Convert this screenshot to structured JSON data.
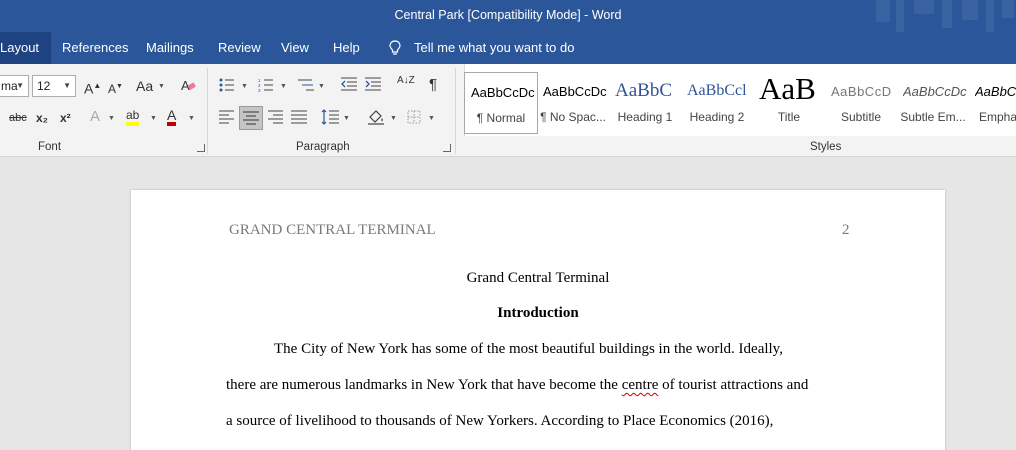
{
  "window": {
    "title": "Central Park [Compatibility Mode]  -  Word"
  },
  "menu": {
    "tabs": [
      "Layout",
      "References",
      "Mailings",
      "Review",
      "View",
      "Help"
    ],
    "tell_me": "Tell me what you want to do"
  },
  "ribbon": {
    "font": {
      "name": "ma",
      "size": "12",
      "group_label": "Font",
      "grow": "A",
      "shrink": "A",
      "case": "Aa",
      "strike": "abc",
      "subscript": "x₂",
      "superscript": "x²",
      "effects": "A",
      "highlight": "ab",
      "font_color": "A"
    },
    "paragraph": {
      "group_label": "Paragraph",
      "sort": "A↓Z",
      "pilcrow": "¶"
    },
    "styles": {
      "group_label": "Styles",
      "items": [
        {
          "preview": "AaBbCcDc",
          "name": "¶ Normal"
        },
        {
          "preview": "AaBbCcDc",
          "name": "¶ No Spac..."
        },
        {
          "preview": "AaBbC",
          "name": "Heading 1"
        },
        {
          "preview": "AaBbCcl",
          "name": "Heading 2"
        },
        {
          "preview": "AaB",
          "name": "Title"
        },
        {
          "preview": "AaBbCcD",
          "name": "Subtitle"
        },
        {
          "preview": "AaBbCcDc",
          "name": "Subtle Em..."
        },
        {
          "preview": "AaBbCc",
          "name": "Empha"
        }
      ]
    }
  },
  "document": {
    "header_left": "GRAND CENTRAL TERMINAL",
    "page_number": "2",
    "title": "Grand Central Terminal",
    "heading": "Introduction",
    "line1": "The City of New York has some of the most beautiful buildings in the world. Ideally,",
    "line2_a": "there are numerous landmarks in New York that have become the ",
    "line2_misspelled": "centre",
    "line2_b": " of tourist attractions and",
    "line3": "a source of livelihood to thousands of New Yorkers. According to Place Economics (2016),"
  }
}
